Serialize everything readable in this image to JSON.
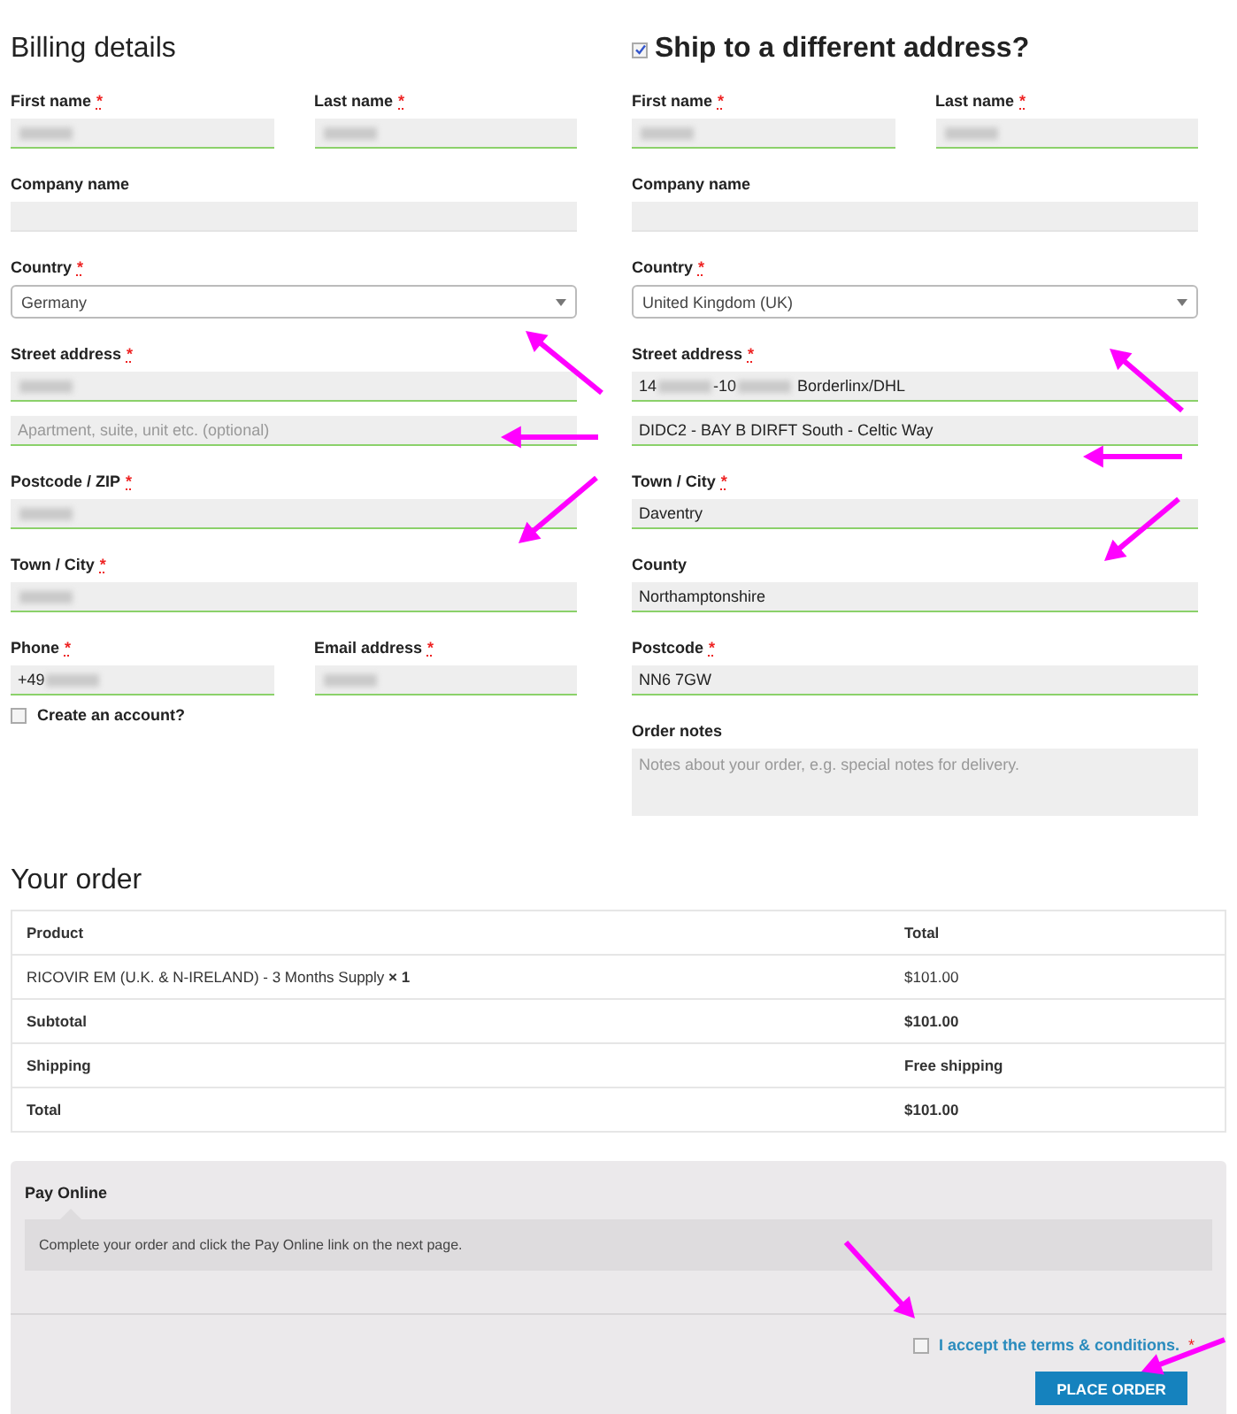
{
  "billing": {
    "title": "Billing details",
    "rows": [
      {
        "fields": [
          {
            "label": "First name",
            "required_mark": "*",
            "kind": "text",
            "inputs": [
              {
                "parts": [
                  {
                    "kind": "blur"
                  }
                ]
              }
            ]
          },
          {
            "label": "Last name",
            "required_mark": "*",
            "kind": "text",
            "inputs": [
              {
                "parts": [
                  {
                    "kind": "blur"
                  }
                ]
              }
            ]
          }
        ]
      },
      {
        "fields": [
          {
            "label": "Company name",
            "kind": "text"
          }
        ]
      },
      {
        "fields": [
          {
            "label": "Country",
            "required_mark": "*",
            "kind": "select",
            "inputs": [
              {
                "parts": [
                  {
                    "kind": "text",
                    "text": "Germany"
                  }
                ]
              }
            ]
          }
        ]
      },
      {
        "fields": [
          {
            "label": "Street address",
            "required_mark": "*",
            "kind": "text",
            "inputs": [
              {
                "parts": [
                  {
                    "kind": "blur"
                  }
                ]
              },
              {
                "placeholder": "Apartment, suite, unit etc. (optional)"
              }
            ]
          }
        ]
      },
      {
        "fields": [
          {
            "label": "Postcode / ZIP",
            "required_mark": "*",
            "kind": "text",
            "inputs": [
              {
                "parts": [
                  {
                    "kind": "blur"
                  }
                ]
              }
            ]
          }
        ]
      },
      {
        "fields": [
          {
            "label": "Town / City",
            "required_mark": "*",
            "kind": "text",
            "inputs": [
              {
                "parts": [
                  {
                    "kind": "blur"
                  }
                ]
              }
            ]
          }
        ]
      },
      {
        "fields": [
          {
            "label": "Phone",
            "required_mark": "*",
            "kind": "text",
            "inputs": [
              {
                "parts": [
                  {
                    "kind": "text",
                    "text": "+49"
                  },
                  {
                    "kind": "blur"
                  }
                ]
              }
            ]
          },
          {
            "label": "Email address",
            "required_mark": "*",
            "kind": "text",
            "inputs": [
              {
                "parts": [
                  {
                    "kind": "blur"
                  }
                ]
              }
            ]
          }
        ]
      }
    ],
    "create_account": {
      "label": "Create an account?",
      "checked": false
    }
  },
  "shipping": {
    "title": "Ship to a different address?",
    "checked": true,
    "rows": [
      {
        "fields": [
          {
            "label": "First name",
            "required_mark": "*",
            "kind": "text",
            "inputs": [
              {
                "parts": [
                  {
                    "kind": "blur"
                  }
                ]
              }
            ]
          },
          {
            "label": "Last name",
            "required_mark": "*",
            "kind": "text",
            "inputs": [
              {
                "parts": [
                  {
                    "kind": "blur"
                  }
                ]
              }
            ]
          }
        ]
      },
      {
        "fields": [
          {
            "label": "Company name",
            "kind": "text"
          }
        ]
      },
      {
        "fields": [
          {
            "label": "Country",
            "required_mark": "*",
            "kind": "select",
            "inputs": [
              {
                "parts": [
                  {
                    "kind": "text",
                    "text": "United Kingdom (UK)"
                  }
                ]
              }
            ]
          }
        ]
      },
      {
        "fields": [
          {
            "label": "Street address",
            "required_mark": "*",
            "kind": "text",
            "inputs": [
              {
                "parts": [
                  {
                    "kind": "text",
                    "text": "14"
                  },
                  {
                    "kind": "blur"
                  },
                  {
                    "kind": "text",
                    "text": "-10"
                  },
                  {
                    "kind": "blur"
                  },
                  {
                    "kind": "text",
                    "text": " Borderlinx/DHL"
                  }
                ]
              },
              {
                "parts": [
                  {
                    "kind": "text",
                    "text": "DIDC2 - BAY B DIRFT South - Celtic Way"
                  }
                ]
              }
            ]
          }
        ]
      },
      {
        "fields": [
          {
            "label": "Town / City",
            "required_mark": "*",
            "kind": "text",
            "inputs": [
              {
                "parts": [
                  {
                    "kind": "text",
                    "text": "Daventry"
                  }
                ]
              }
            ]
          }
        ]
      },
      {
        "fields": [
          {
            "label": "County",
            "kind": "text",
            "inputs": [
              {
                "parts": [
                  {
                    "kind": "text",
                    "text": "Northamptonshire"
                  }
                ]
              }
            ]
          }
        ]
      },
      {
        "fields": [
          {
            "label": "Postcode",
            "required_mark": "*",
            "kind": "text",
            "inputs": [
              {
                "parts": [
                  {
                    "kind": "text",
                    "text": "NN6 7GW"
                  }
                ]
              }
            ]
          }
        ]
      },
      {
        "fields": [
          {
            "label": "Order notes",
            "kind": "textarea",
            "inputs": [
              {
                "placeholder": "Notes about your order, e.g. special notes for delivery."
              }
            ]
          }
        ]
      }
    ]
  },
  "order": {
    "title": "Your order",
    "columns": [
      "Product",
      "Total"
    ],
    "rows": [
      {
        "kind": "item",
        "cells": [
          "RICOVIR EM (U.K. & N-IRELAND) - 3 Months Supply  **× 1**",
          "$101.00"
        ]
      },
      {
        "kind": "total",
        "cells": [
          "Subtotal",
          "$101.00"
        ]
      },
      {
        "kind": "total",
        "cells": [
          "Shipping",
          "Free shipping"
        ]
      },
      {
        "kind": "total",
        "cells": [
          "Total",
          "$101.00"
        ]
      }
    ]
  },
  "payment": {
    "method": "Pay Online",
    "description": "Complete your order and click the Pay Online link on the next page.",
    "terms": {
      "label": "I accept the terms & conditions.",
      "required_mark": "*",
      "checked": false
    },
    "button": "PLACE ORDER"
  }
}
